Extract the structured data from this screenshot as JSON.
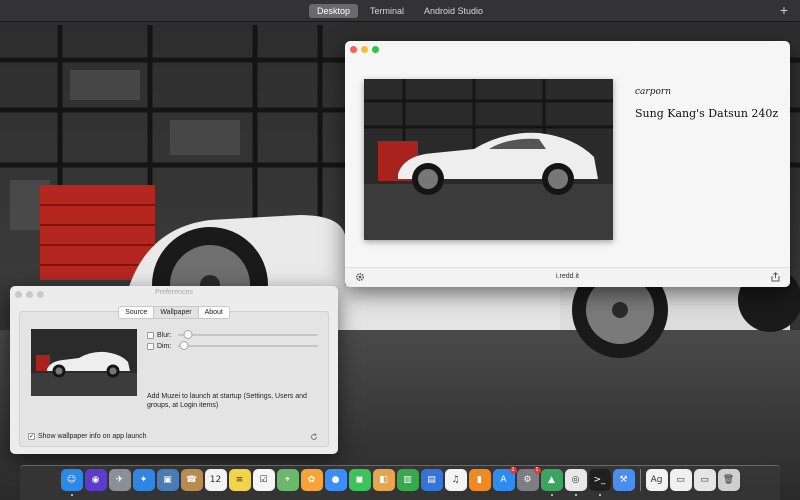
{
  "topbar": {
    "spaces": [
      "Desktop",
      "Terminal",
      "Android Studio"
    ],
    "active_space": "Desktop",
    "add_space_label": "+"
  },
  "info_window": {
    "byline": "carporn",
    "title": "Sung Kang's Datsun 240z",
    "source": "i.redd.it",
    "settings_icon": "gear-icon",
    "share_icon": "share-icon"
  },
  "preferences": {
    "title": "Preferences",
    "tabs": [
      "Source",
      "Wallpaper",
      "About"
    ],
    "selected_tab": "Wallpaper",
    "blur": {
      "label": "Blur:",
      "checked": false,
      "value": 0.07
    },
    "dim": {
      "label": "Dim:",
      "checked": false,
      "value": 0.04
    },
    "startup_text": "Add Muzei to launch at startup (Settings, Users and groups, at Login items)",
    "show_info": {
      "label": "Show wallpaper info on app launch",
      "checked": true,
      "check_mark": "✓"
    },
    "refresh_icon": "refresh-icon"
  },
  "dock": {
    "icons": [
      {
        "name": "finder-icon",
        "glyph": "☺",
        "color": "#2b8ae8",
        "running": true
      },
      {
        "name": "siri-icon",
        "glyph": "◉",
        "color": "#5b3ccc",
        "running": false
      },
      {
        "name": "launchpad-icon",
        "glyph": "✈",
        "color": "#8a8f98",
        "running": false
      },
      {
        "name": "safari-icon",
        "glyph": "✦",
        "color": "#2f86e0",
        "running": false
      },
      {
        "name": "photo-viewer-icon",
        "glyph": "▣",
        "color": "#4a7bb7",
        "running": false
      },
      {
        "name": "contacts-icon",
        "glyph": "☎",
        "color": "#b88b53",
        "running": false
      },
      {
        "name": "calendar-icon",
        "glyph": "12",
        "color": "#f3f3f3",
        "running": false
      },
      {
        "name": "notes-icon",
        "glyph": "≡",
        "color": "#f1d44a",
        "running": false
      },
      {
        "name": "reminders-icon",
        "glyph": "☑",
        "color": "#f5f5f5",
        "running": false
      },
      {
        "name": "maps-icon",
        "glyph": "⌖",
        "color": "#6cb86a",
        "running": false
      },
      {
        "name": "photos-icon",
        "glyph": "✿",
        "color": "#f6a33a",
        "running": false
      },
      {
        "name": "messages-bubble-icon",
        "glyph": "●",
        "color": "#3a8ef5",
        "running": false
      },
      {
        "name": "facetime-icon",
        "glyph": "◼",
        "color": "#3ec35a",
        "running": false
      },
      {
        "name": "preview-icon",
        "glyph": "◧",
        "color": "#e6a64d",
        "running": false
      },
      {
        "name": "numbers-icon",
        "glyph": "▥",
        "color": "#38a84c",
        "running": false
      },
      {
        "name": "keynote-icon",
        "glyph": "▤",
        "color": "#3473d8",
        "running": false
      },
      {
        "name": "music-icon",
        "glyph": "♫",
        "color": "#f4f4f4",
        "running": false
      },
      {
        "name": "books-icon",
        "glyph": "▮",
        "color": "#f08a1e",
        "running": false
      },
      {
        "name": "app-store-icon",
        "glyph": "A",
        "color": "#2e8cf0",
        "running": false,
        "badge": "2"
      },
      {
        "name": "system-preferences-icon",
        "glyph": "⚙",
        "color": "#7d7d84",
        "running": false,
        "badge": "1"
      },
      {
        "name": "android-studio-icon",
        "glyph": "▲",
        "color": "#3ba55d",
        "running": true
      },
      {
        "name": "chrome-icon",
        "glyph": "◎",
        "color": "#e8e8e8",
        "running": true
      },
      {
        "name": "terminal-icon",
        "glyph": ">_",
        "color": "#202020",
        "running": true
      },
      {
        "name": "xcode-icon",
        "glyph": "⚒",
        "color": "#4a8ff0",
        "running": false
      },
      {
        "name": "font-book-icon",
        "glyph": "Ag",
        "color": "#f2f2f2",
        "running": false
      },
      {
        "name": "downloads-stack-icon",
        "glyph": "▭",
        "color": "#f0f0f0",
        "running": false
      },
      {
        "name": "documents-stack-icon",
        "glyph": "▭",
        "color": "#e5e5e5",
        "running": false
      },
      {
        "name": "trash-icon",
        "glyph": "🗑",
        "color": "#cfcfcf",
        "running": false
      }
    ]
  }
}
